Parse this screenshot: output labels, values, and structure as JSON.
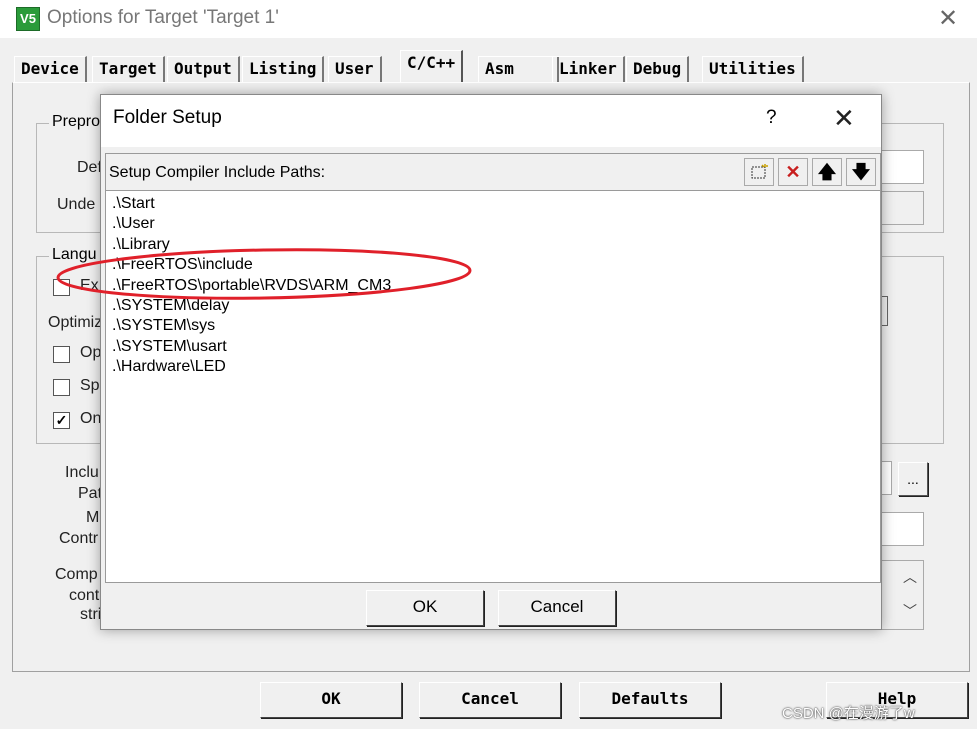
{
  "window": {
    "title": "Options for Target 'Target 1'",
    "icon_label": "V5",
    "close_label": "✕"
  },
  "tabs": [
    {
      "label": "Device"
    },
    {
      "label": "Target"
    },
    {
      "label": "Output"
    },
    {
      "label": "Listing"
    },
    {
      "label": "User"
    },
    {
      "label": "C/C++"
    },
    {
      "label": "Asm"
    },
    {
      "label": "Linker"
    },
    {
      "label": "Debug"
    },
    {
      "label": "Utilities"
    }
  ],
  "active_tab": "C/C++",
  "background_panel": {
    "preprocessor_label": "Prepro",
    "define_label": "Def",
    "undefine_label": "Unde",
    "language_label": "Langu",
    "ex_label": "Ex",
    "optimiz_label": "Optimiz",
    "op_label": "Op",
    "sp_label": "Sp",
    "on_label": "On",
    "include_label": "Inclu",
    "paths_label": "Pat",
    "misc_label": "M",
    "controls_label": "Contr",
    "compiler_label": "Comp",
    "control_label": "cont",
    "string_label": "stri",
    "ellipsis_label": "...",
    "on_checked": true,
    "ex_checked": false,
    "op_checked": false,
    "sp_checked": false
  },
  "bottom_buttons": {
    "ok": "OK",
    "cancel": "Cancel",
    "defaults": "Defaults",
    "help": "Help"
  },
  "watermark": "CSDN @在漫游了w",
  "dialog": {
    "title": "Folder Setup",
    "help_label": "?",
    "close_label": "✕",
    "list_header": "Setup Compiler Include Paths:",
    "paths": [
      ".\\Start",
      ".\\User",
      ".\\Library",
      ".\\FreeRTOS\\include",
      ".\\FreeRTOS\\portable\\RVDS\\ARM_CM3",
      ".\\SYSTEM\\delay",
      ".\\SYSTEM\\sys",
      ".\\SYSTEM\\usart",
      ".\\Hardware\\LED"
    ],
    "ok_label": "OK",
    "cancel_label": "Cancel",
    "highlight_color": "#e0202a"
  }
}
